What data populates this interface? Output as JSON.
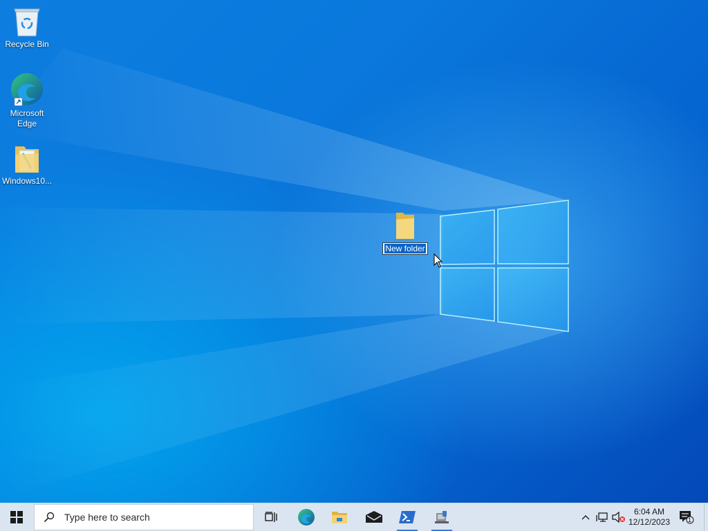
{
  "desktop": {
    "icons": [
      {
        "label": "Recycle Bin",
        "icon": "recycle-bin-icon"
      },
      {
        "label": "Microsoft Edge",
        "icon": "edge-icon"
      },
      {
        "label": "Windows10...",
        "icon": "folder-icon"
      }
    ],
    "new_folder": {
      "label": "New folder",
      "icon": "folder-icon",
      "state": "renaming"
    }
  },
  "taskbar": {
    "search_placeholder": "Type here to search",
    "apps": [
      {
        "name": "task-view",
        "icon": "task-view-icon"
      },
      {
        "name": "edge",
        "icon": "edge-icon"
      },
      {
        "name": "file-explorer",
        "icon": "folder-icon"
      },
      {
        "name": "mail",
        "icon": "mail-icon"
      },
      {
        "name": "powershell",
        "icon": "powershell-icon",
        "active": true
      },
      {
        "name": "app",
        "icon": "app-icon",
        "active": true
      }
    ],
    "clock": {
      "time": "6:04 AM",
      "date": "12/12/2023"
    },
    "notifications_count": "1"
  },
  "colors": {
    "accent": "#0a64c8",
    "taskbar": "#dbe5f1"
  }
}
